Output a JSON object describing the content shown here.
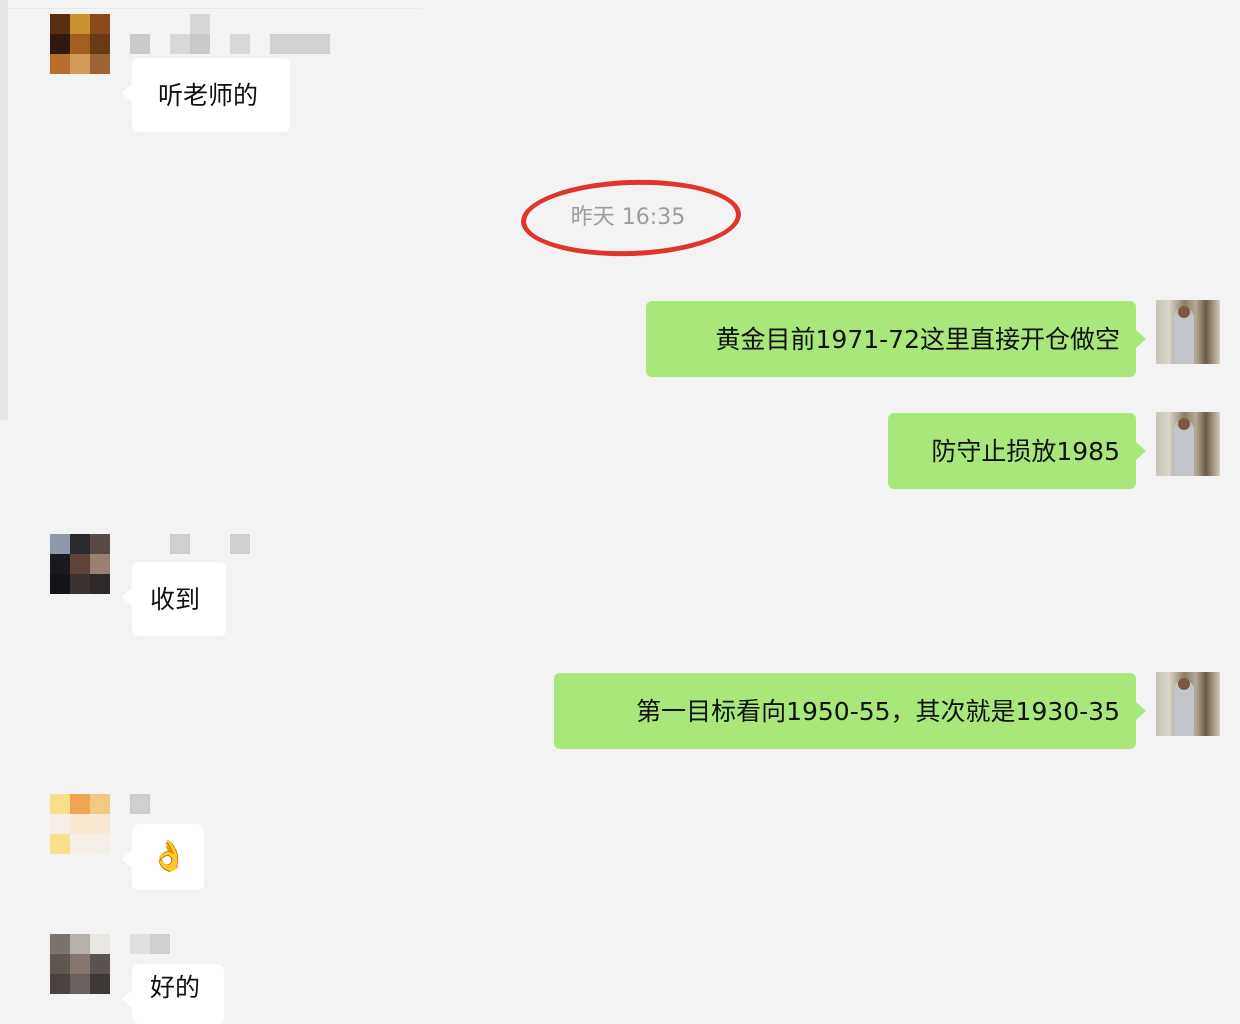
{
  "chat": {
    "timestamp": "昨天 16:35",
    "messages": [
      {
        "direction": "in",
        "text": "听老师的"
      },
      {
        "direction": "out",
        "text": "黄金目前1971-72这里直接开仓做空"
      },
      {
        "direction": "out",
        "text": "防守止损放1985"
      },
      {
        "direction": "in",
        "text": "收到"
      },
      {
        "direction": "out",
        "text": "第一目标看向1950-55，其次就是1930-35"
      },
      {
        "direction": "in",
        "text": "👌"
      },
      {
        "direction": "in",
        "text": "好的"
      }
    ]
  },
  "annotation": {
    "ring_color": "#e0352a"
  },
  "colors": {
    "background": "#f3f3f3",
    "incoming_bubble": "#ffffff",
    "outgoing_bubble": "#a8e87b",
    "timestamp_text": "#9c9c9c"
  }
}
